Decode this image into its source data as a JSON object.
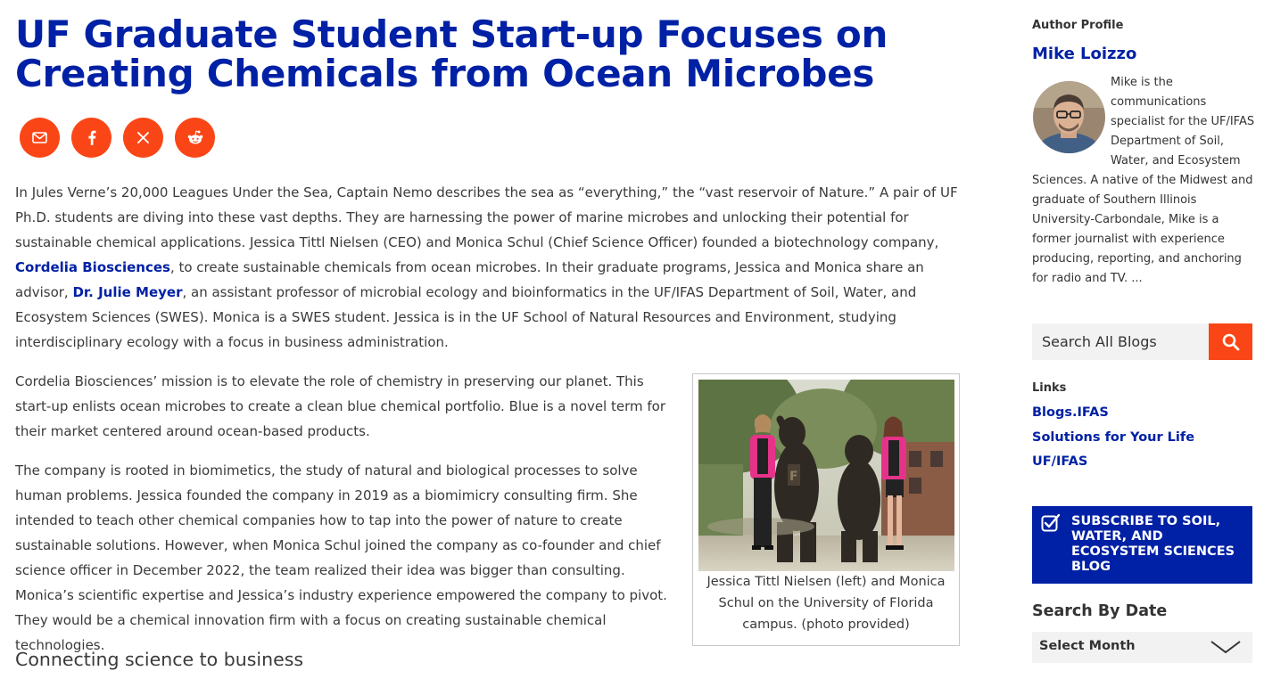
{
  "article": {
    "title": "UF Graduate Student Start-up Focuses on Creating Chemicals from Ocean Microbes",
    "share": [
      "email-icon",
      "facebook-icon",
      "x-icon",
      "reddit-icon"
    ],
    "p1": {
      "a": "In Jules Verne’s 20,000 Leagues Under the Sea, Captain Nemo describes the sea as “everything,” the “vast reservoir of Nature.” A pair of UF Ph.D. students are diving into these vast depths. They are harnessing the power of marine microbes and unlocking their potential for sustainable chemical applications. Jessica Tittl Nielsen (CEO) and Monica Schul (Chief Science Officer) founded a biotechnology company, ",
      "link1": "Cordelia Biosciences",
      "b": ", to create sustainable chemicals from ocean microbes. In their graduate programs, Jessica and Monica share an advisor, ",
      "link2": "Dr. Julie Meyer",
      "c": ", an assistant professor of microbial ecology and bioinformatics in the UF/IFAS Department of Soil, Water, and Ecosystem Sciences (SWES). Monica is a SWES student. Jessica is in the UF School of Natural Resources and Environment, studying interdisciplinary ecology with a focus in business administration."
    },
    "p2": "Cordelia Biosciences’ mission is to elevate the role of chemistry in preserving our planet. This start-up enlists ocean microbes to create a clean blue chemical portfolio. Blue is a novel term for their market centered around ocean-based products.",
    "p3": "The company is rooted in biomimetics, the study of natural and biological processes to solve human problems. Jessica founded the company in 2019 as a biomimicry consulting firm. She intended to teach other chemical companies how to tap into the power of nature to create sustainable solutions. However, when Monica Schul joined the company as co-founder and chief science officer in December 2022, the team realized their idea was bigger than consulting. Monica’s scientific expertise and Jessica’s industry experience empowered the company to pivot. They would be a chemical innovation firm with a focus on creating sustainable chemical technologies.",
    "figure_caption": "Jessica Tittl Nielsen (left) and Monica Schul on the University of Florida campus. (photo provided)",
    "subheading": "Connecting science to business"
  },
  "sidebar": {
    "author_label": "Author Profile",
    "author_name": "Mike Loizzo",
    "author_bio": "Mike is the communications specialist for the UF/IFAS Department of Soil, Water, and Ecosystem Sciences. A native of the Midwest and graduate of Southern Illinois University-Carbondale, Mike is a former journalist with experience producing, reporting, and anchoring for radio and TV. ...",
    "search_placeholder": "Search All Blogs",
    "links_label": "Links",
    "links": [
      "Blogs.IFAS",
      "Solutions for Your Life",
      "UF/IFAS"
    ],
    "subscribe": "Subscribe to Soil, Water, and Ecosystem Sciences Blog",
    "date_heading": "Search By Date",
    "month_select": "Select Month"
  },
  "colors": {
    "brand_blue": "#0021a5",
    "accent_orange": "#fa4616",
    "text": "#3a3a3a"
  }
}
